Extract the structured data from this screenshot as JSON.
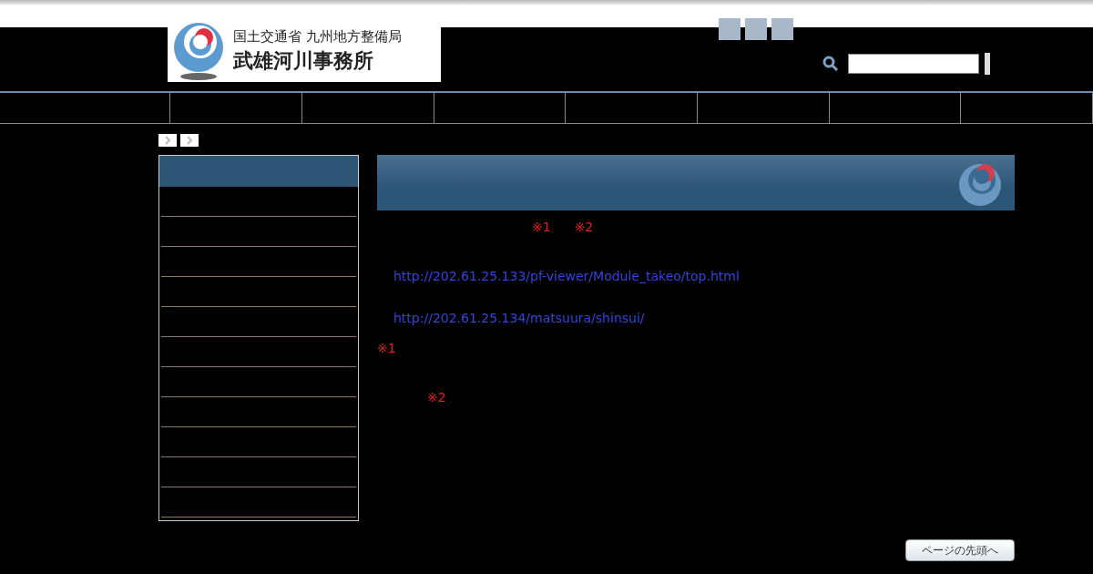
{
  "header": {
    "logo": {
      "ministry": "国土交通省 九州地方整備局",
      "office": "武雄河川事務所"
    }
  },
  "content": [
    {
      "kind": "marks",
      "texts": [
        "※1",
        "※2"
      ]
    },
    {
      "kind": "link",
      "text": "http://202.61.25.133/pf-viewer/Module_takeo/top.html"
    },
    {
      "kind": "link",
      "text": "http://202.61.25.134/matsuura/shinsui/"
    },
    {
      "kind": "note",
      "text": "※1"
    },
    {
      "kind": "note2",
      "text": "※2"
    }
  ],
  "page_top": "ページの先頭へ"
}
